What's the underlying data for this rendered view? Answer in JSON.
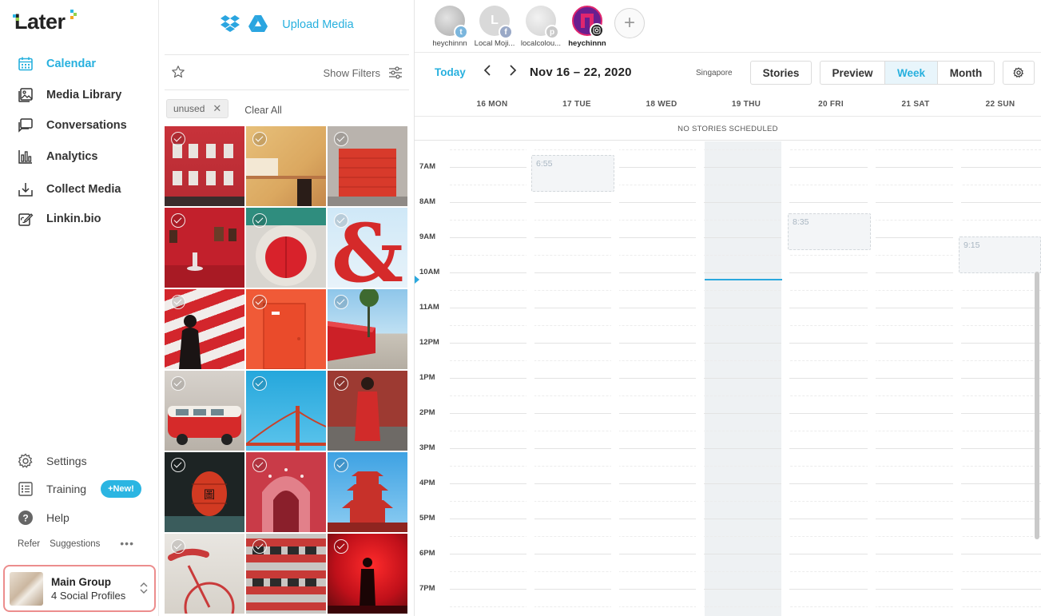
{
  "app": {
    "logo_text": "Later"
  },
  "sidebar": {
    "items": [
      {
        "label": "Calendar",
        "icon": "calendar-icon",
        "active": true
      },
      {
        "label": "Media Library",
        "icon": "image-icon"
      },
      {
        "label": "Conversations",
        "icon": "chat-icon"
      },
      {
        "label": "Analytics",
        "icon": "bar-chart-icon"
      },
      {
        "label": "Collect Media",
        "icon": "download-tray-icon"
      },
      {
        "label": "Linkin.bio",
        "icon": "link-edit-icon"
      }
    ],
    "bottom_items": [
      {
        "label": "Settings",
        "icon": "gear-icon"
      },
      {
        "label": "Training",
        "icon": "checklist-icon",
        "badge": "+New!"
      },
      {
        "label": "Help",
        "icon": "help-icon"
      }
    ],
    "refer": "Refer",
    "suggestions": "Suggestions",
    "more": "•••",
    "group": {
      "name": "Main Group",
      "subtitle": "4 Social Profiles"
    },
    "accent_color": "#27b0de"
  },
  "media": {
    "upload_label": "Upload Media",
    "show_filters": "Show Filters",
    "tag": "unused",
    "clear_all": "Clear All"
  },
  "calendar": {
    "profiles": [
      {
        "name": "heychinnn",
        "network": "twitter"
      },
      {
        "name": "Local Moji...",
        "network": "facebook"
      },
      {
        "name": "localcolou...",
        "network": "pinterest"
      },
      {
        "name": "heychinnn",
        "network": "instagram",
        "active": true
      }
    ],
    "today_label": "Today",
    "prev_icon": "chevron-left-icon",
    "next_icon": "chevron-right-icon",
    "date_range": "Nov 16 – 22, 2020",
    "timezone": "Singapore",
    "stories_button": "Stories",
    "views": [
      "Preview",
      "Week",
      "Month"
    ],
    "active_view": "Week",
    "settings_icon": "gear-icon",
    "days": [
      "16 MON",
      "17 TUE",
      "18 WED",
      "19 THU",
      "20 FRI",
      "21 SAT",
      "22 SUN"
    ],
    "today_index": 3,
    "no_stories": "NO STORIES SCHEDULED",
    "hours": [
      "7AM",
      "8AM",
      "9AM",
      "10AM",
      "11AM",
      "12PM",
      "1PM",
      "2PM",
      "3PM",
      "4PM",
      "5PM",
      "6PM",
      "7PM"
    ],
    "slots": [
      {
        "day_index": 1,
        "time": "6:55"
      },
      {
        "day_index": 4,
        "time": "8:35"
      },
      {
        "day_index": 6,
        "time": "9:15"
      }
    ]
  }
}
